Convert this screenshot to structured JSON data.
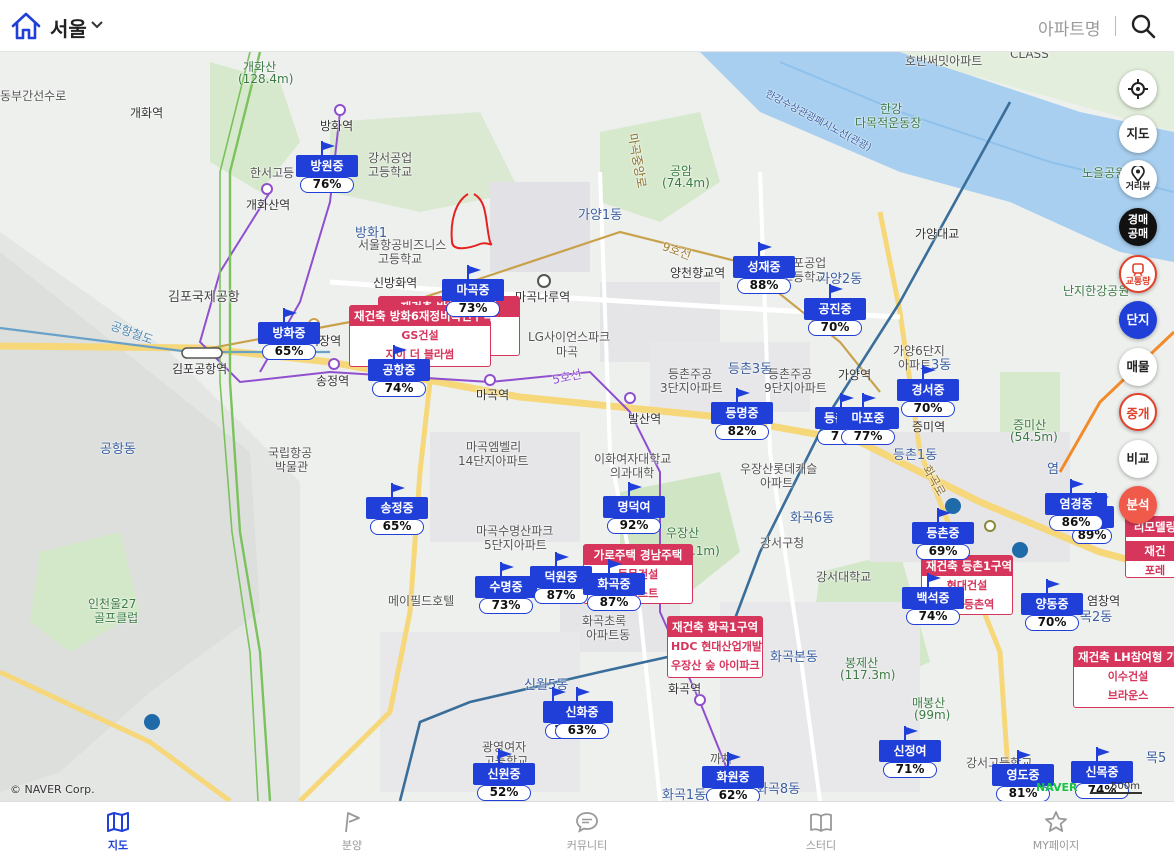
{
  "header": {
    "region": "서울",
    "apt_search": "아파트명"
  },
  "map_labels": {
    "gaehwa_san": "개화산",
    "gaehwa_san_h": "(128.4m)",
    "dongbu": "동부간선수로",
    "gaehwa_st": "개화역",
    "banghwa_st": "방화역",
    "gaehwasan_st": "개화산역",
    "gangseo_tech": "강서공업",
    "gangseo_tech2": "고등학교",
    "hanseo": "한서고등",
    "banghwa1": "방화1",
    "aviation": "서울항공비즈니스",
    "aviation2": "고등학교",
    "gimpo_intl": "김포국제공항",
    "sinbanghwa_st": "신방화역",
    "magoknaru_st": "마곡나루역",
    "sijang_st": "시장역",
    "gimpo_airport_st": "김포공항역",
    "songjeong_st": "송정역",
    "lg": "LG사이언스파크",
    "magok": "마곡",
    "gayang1": "가양1동",
    "gongam": "공암",
    "gongam_h": "(74.4m)",
    "yangcheonhyanggyo_st": "양천향교역",
    "gyeonggong": "등포공업",
    "gyeonggong2": "고등학교",
    "gayang2": "가양2동",
    "gayangdaegyo": "가양대교",
    "hobanssi": "호반써밋아파트",
    "class": "CLASS",
    "hangang": "한강",
    "hangang_sports": "다목적운동장",
    "tunnel": "한강수상관광폐시노선(관광)",
    "noeul": "노을공원",
    "nanji": "난지한강공원",
    "gayang6": "가양6단지",
    "gayang6b": "아파트",
    "gayang3": "3동",
    "gayang_st": "가양역",
    "deungchon_ju": "등촌주공",
    "deungchon_ju2": "3단지아파트",
    "deungchon3": "등촌3동",
    "deungchon_ju9": "등촌주공",
    "deungchon_ju9b": "9단지아파트",
    "deungchon1": "등촌1동",
    "jeungmi_st": "증미역",
    "jeungmisan": "증미산",
    "jeungmisan_h": "(54.5m)",
    "magok_st": "마곡역",
    "balsan_st": "발산역",
    "magok_emv": "마곡엠벨리",
    "magok_emv2": "14단지아파트",
    "ewha": "이화여자대학교",
    "ewha2": "의과대학",
    "ujangsan_lotte": "우장산롯데캐슬",
    "ujangsan_lotte2": "아파트",
    "ujangsan": "우장산",
    "ujangsan_h": "(96.1m)",
    "gangseo_gu": "강서구청",
    "hwagok6": "화곡6동",
    "gangseo_univ": "강서대학교",
    "gonghang": "공항동",
    "airport_museum": "국립항공",
    "airport_museum2": "박물관",
    "magok_suyoung": "마곡수명산파크",
    "magok_suyoung2": "5단지아파트",
    "mayfield": "메이필드호텔",
    "incheon_golf": "인천울27",
    "incheon_golf2": "골프클럽",
    "hwagok_chorok": "화곡초록",
    "hwagok_chorok2": "아파트동",
    "sinwol5": "신월5동",
    "gwangyeong": "광영여자",
    "gwangyeong2": "고등학교",
    "hwagok_st": "화곡역",
    "hwagokbon": "화곡본동",
    "bonghwasan": "봉제산",
    "bonghwasan_h": "(117.3m)",
    "maebongsan": "매봉산",
    "maebongsan_h": "(99m)",
    "kkachi": "까치",
    "hwagok1": "화곡1동",
    "hwagok8": "화곡8동",
    "gangseo_hs": "강서고등학교",
    "yeomchang_st": "염창역",
    "mok2": "목2동",
    "mok5": "목5",
    "yeom": "염",
    "line5": "5호선",
    "line9": "9호선",
    "airport_rr": "공항철도",
    "hwagok_ro": "화곡로",
    "magokjungang": "마곡중앙로"
  },
  "schools": [
    {
      "name": "방원중",
      "pct": "76%"
    },
    {
      "name": "마곡중",
      "pct": "73%"
    },
    {
      "name": "방화중",
      "pct": "65%"
    },
    {
      "name": "공항중",
      "pct": "74%"
    },
    {
      "name": "성재중",
      "pct": "88%"
    },
    {
      "name": "공진중",
      "pct": "70%"
    },
    {
      "name": "등명중",
      "pct": "82%"
    },
    {
      "name": "등촌",
      "pct": "7"
    },
    {
      "name": "마포중",
      "pct": "77%"
    },
    {
      "name": "경서중",
      "pct": "70%"
    },
    {
      "name": "송정중",
      "pct": "65%"
    },
    {
      "name": "명덕여",
      "pct": "92%"
    },
    {
      "name": "수명중",
      "pct": "73%"
    },
    {
      "name": "덕원중",
      "pct": "87%"
    },
    {
      "name": "화곡중",
      "pct": "87%"
    },
    {
      "name": "등촌중",
      "pct": "69%"
    },
    {
      "name": "염경중",
      "pct": "86%"
    },
    {
      "name": "중",
      "pct": "89%"
    },
    {
      "name": "백석중",
      "pct": "74%"
    },
    {
      "name": "양동중",
      "pct": "70%"
    },
    {
      "name": "신",
      "pct": "1"
    },
    {
      "name": "신화중",
      "pct": "63%"
    },
    {
      "name": "신원중",
      "pct": "52%"
    },
    {
      "name": "화원중",
      "pct": "62%"
    },
    {
      "name": "신정여",
      "pct": "71%"
    },
    {
      "name": "영도중",
      "pct": "81%"
    },
    {
      "name": "신목중",
      "pct": "74%"
    }
  ],
  "redev": [
    {
      "title": "재건축 방화6재정비촉진구역",
      "l1": "GS건설",
      "l2": "자이 더 블라썸"
    },
    {
      "title": "재건축 화곡1구역",
      "l1": "HDC 현대산업개발",
      "l2": "우장산 숲 아이파크"
    },
    {
      "title": "가로주택 경남주택",
      "l1": "동문건설",
      "l2": "디이스트"
    },
    {
      "title": "재건축 등촌1구역",
      "l1": "현대건설",
      "l2": "이트 등촌역"
    },
    {
      "title": "재건축 LH참여형 가로",
      "l1": "이수건설",
      "l2": "브라운스"
    },
    {
      "title": "재건축 방화5재정비",
      "l1": "",
      "l2": "아이파크"
    },
    {
      "title": "리모델링",
      "l1": "",
      "l2": ""
    },
    {
      "title": "재건",
      "l1": "포레",
      "l2": ""
    }
  ],
  "controls": {
    "jido": "지도",
    "geori": "거리뷰",
    "gyeongmae": "경매",
    "gongmae": "공매",
    "traffic": "교통량",
    "danji": "단지",
    "maemul": "매물",
    "junggae": "중개",
    "bigyo": "비교",
    "bunseok": "분석"
  },
  "map_footer": {
    "copyright": "© NAVER Corp.",
    "naver": "NAVER",
    "scale": "500m"
  },
  "nav": [
    {
      "label": "지도"
    },
    {
      "label": "분양"
    },
    {
      "label": "커뮤니티"
    },
    {
      "label": "스터디"
    },
    {
      "label": "MY페이지"
    }
  ],
  "colors": {
    "accent": "#1f3fd8",
    "redev": "#d6355c",
    "river": "#a8cff0"
  }
}
